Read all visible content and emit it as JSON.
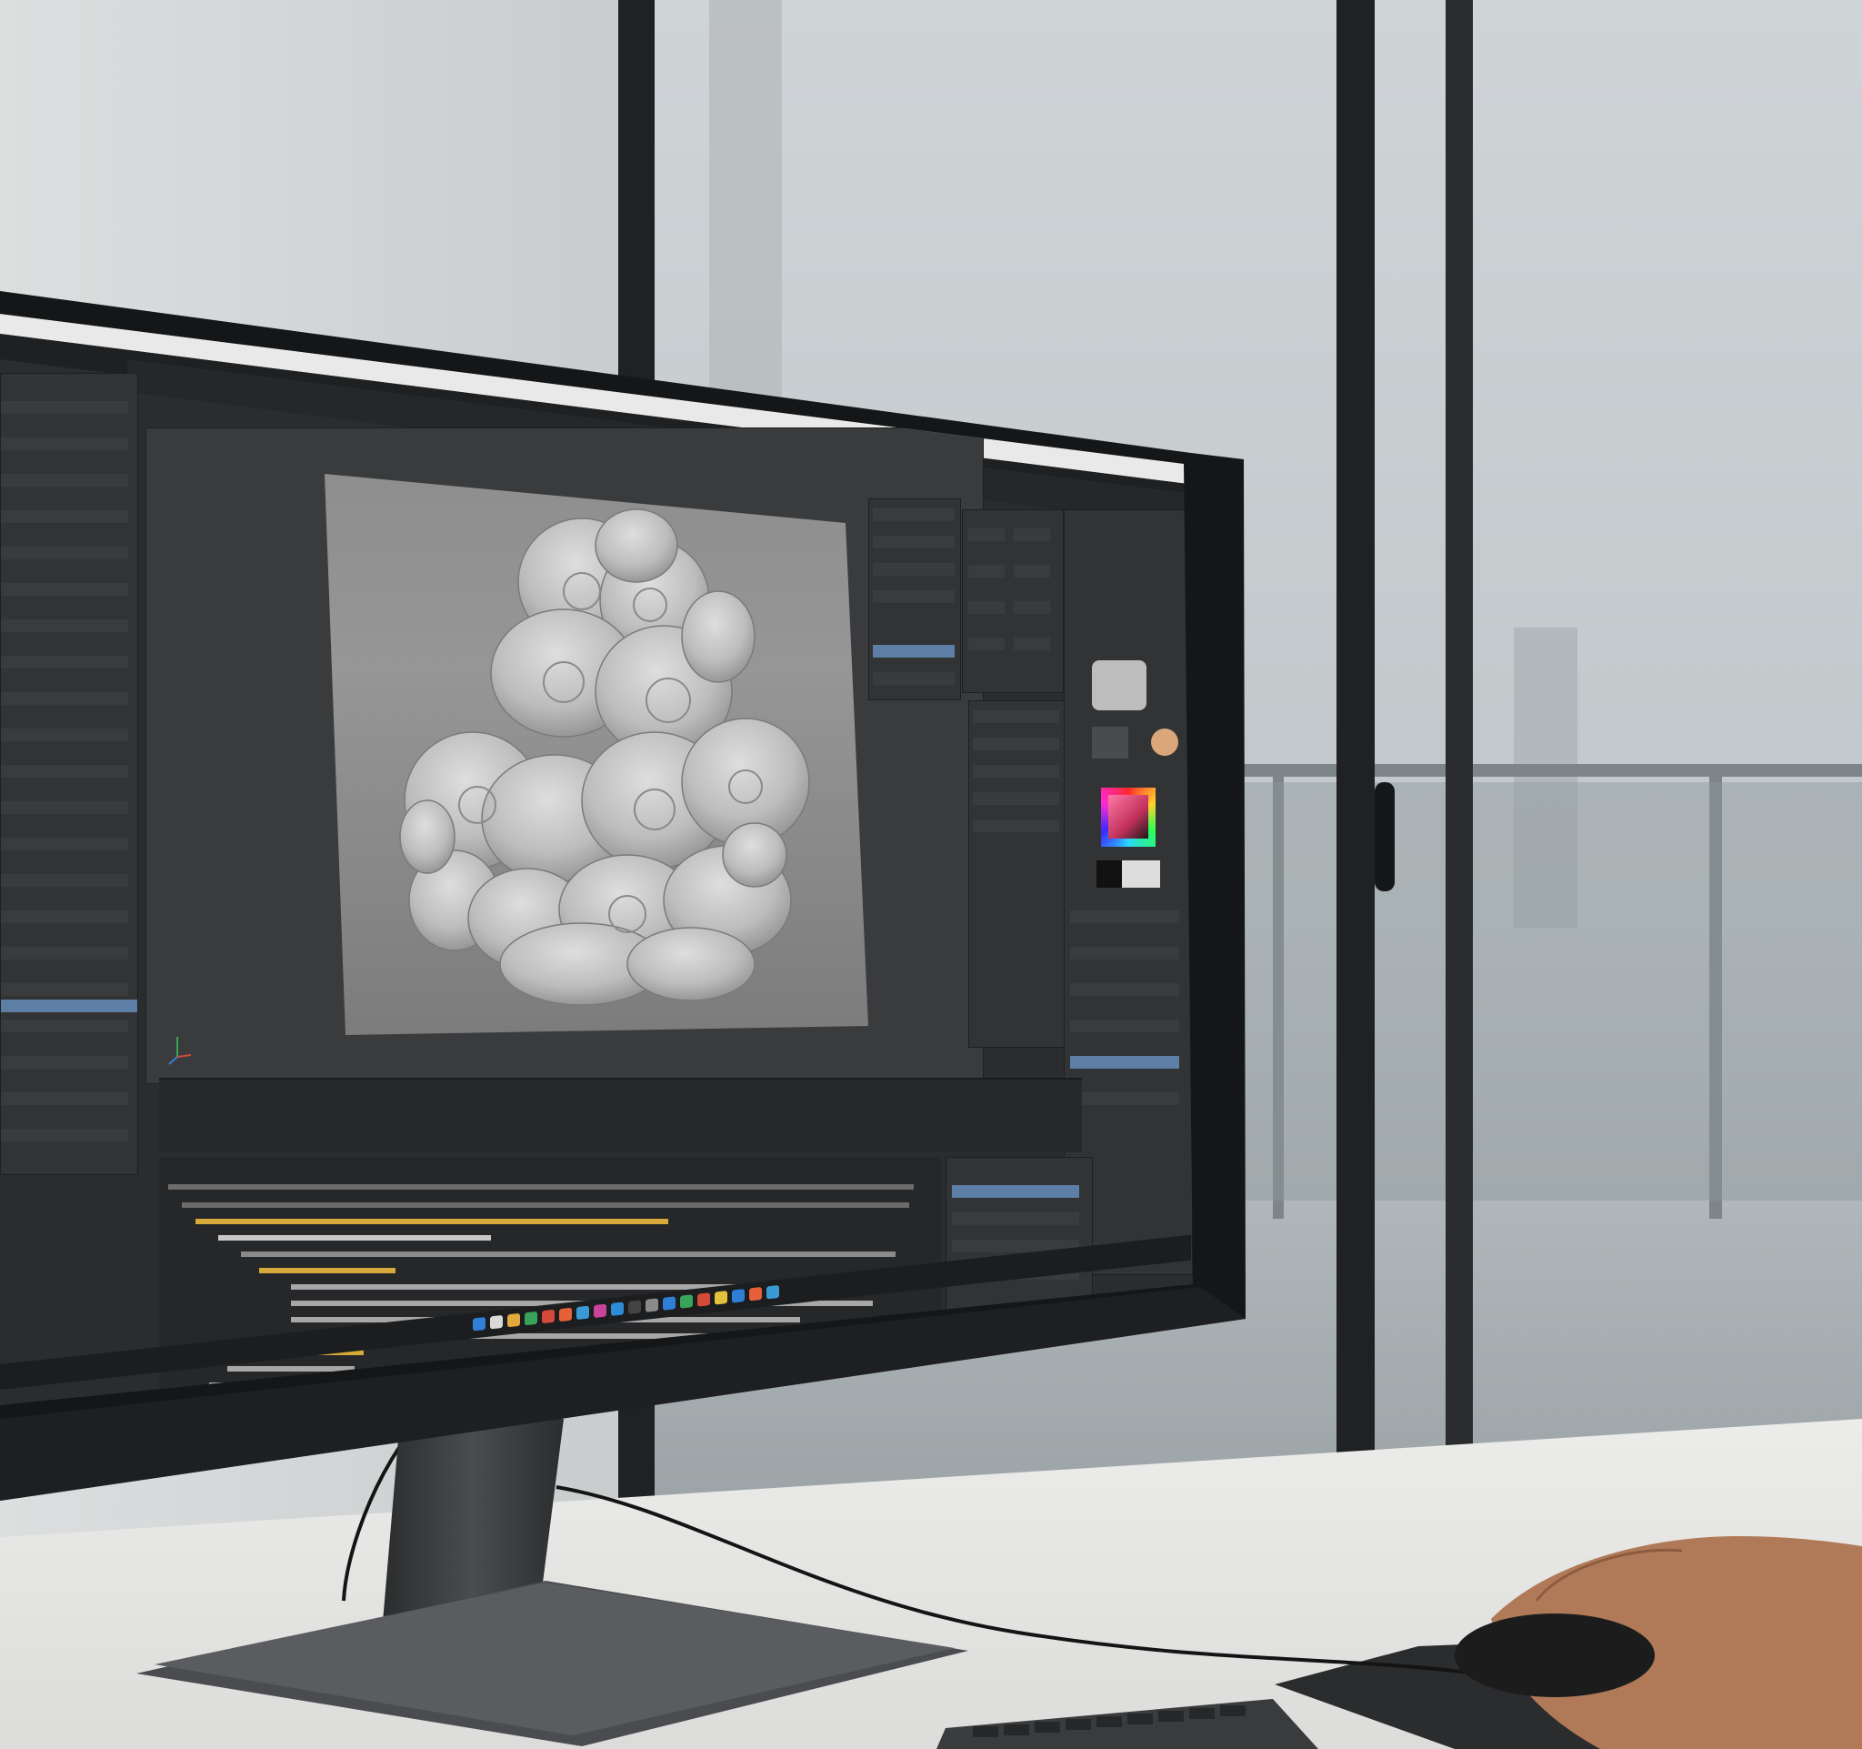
{
  "scene": {
    "description_kind": "photo",
    "colors": {
      "wall": "#d3d5d6",
      "window_glass": "#c2c8cb",
      "window_frame": "#1f2123",
      "desk": "#e9e9e7",
      "monitor_bezel": "#151617",
      "stand": "#3a3c3e",
      "ui_bg": "#2b2c2e",
      "ui_panel": "#323335",
      "viewport": "#8a8a8a",
      "model": "#c9c9c9",
      "selection": "#5d7fa6",
      "code_keyword": "#d6a93a",
      "code_text": "#c8c8c8",
      "skin": "#b07a58",
      "mouse": "#1c1c1d"
    }
  },
  "app": {
    "icons": [
      "move-tool-icon",
      "rotate-tool-icon",
      "scale-tool-icon",
      "brush-tool-icon",
      "render-icon"
    ],
    "color_picker": {
      "hue_top": "#ff2a2a",
      "mid": "#e0305a",
      "base": "#222222"
    }
  },
  "taskbar": {
    "icons": [
      {
        "name": "start-icon",
        "color": "#2f7fd6"
      },
      {
        "name": "search-icon",
        "color": "#d9d9d9"
      },
      {
        "name": "files-icon",
        "color": "#e2a83b"
      },
      {
        "name": "browser-icon",
        "color": "#3aa35a"
      },
      {
        "name": "mail-icon",
        "color": "#d44a3a"
      },
      {
        "name": "music-icon",
        "color": "#e6603a"
      },
      {
        "name": "chat-icon",
        "color": "#3a9ad4"
      },
      {
        "name": "photos-icon",
        "color": "#c9439b"
      },
      {
        "name": "store-icon",
        "color": "#2d8cd6"
      },
      {
        "name": "terminal-icon",
        "color": "#444444"
      },
      {
        "name": "settings-icon",
        "color": "#8a8a8a"
      },
      {
        "name": "code-icon",
        "color": "#2f7fd6"
      },
      {
        "name": "maps-icon",
        "color": "#3aa35a"
      },
      {
        "name": "video-icon",
        "color": "#d44a3a"
      },
      {
        "name": "notes-icon",
        "color": "#e2c23b"
      },
      {
        "name": "calendar-icon",
        "color": "#2f7fd6"
      },
      {
        "name": "design-icon",
        "color": "#e6603a"
      },
      {
        "name": "cloud-icon",
        "color": "#3a9ad4"
      }
    ]
  }
}
